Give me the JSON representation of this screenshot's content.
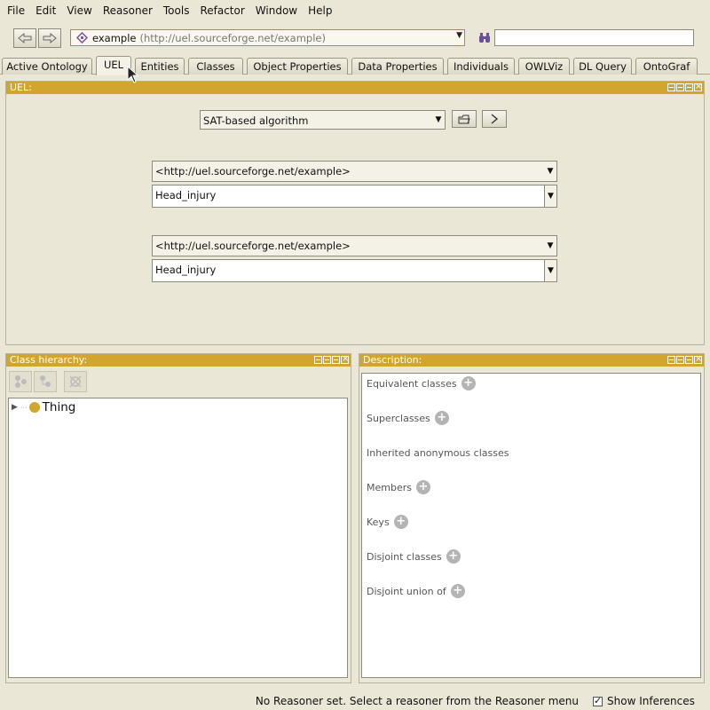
{
  "menu": [
    "File",
    "Edit",
    "View",
    "Reasoner",
    "Tools",
    "Refactor",
    "Window",
    "Help"
  ],
  "toolbar": {
    "back_icon": "back-arrow-icon",
    "forward_icon": "forward-arrow-icon",
    "ontology_name": "example",
    "ontology_iri": "(http://uel.sourceforge.net/example)",
    "search_value": ""
  },
  "tabs": [
    {
      "label": "Active Ontology",
      "active": false
    },
    {
      "label": "UEL",
      "active": true
    },
    {
      "label": "Entities",
      "active": false
    },
    {
      "label": "Classes",
      "active": false
    },
    {
      "label": "Object Properties",
      "active": false
    },
    {
      "label": "Data Properties",
      "active": false
    },
    {
      "label": "Individuals",
      "active": false
    },
    {
      "label": "OWLViz",
      "active": false
    },
    {
      "label": "DL Query",
      "active": false
    },
    {
      "label": "OntoGraf",
      "active": false
    }
  ],
  "uel": {
    "header": "UEL:",
    "algorithm": "SAT-based algorithm",
    "ontology1": "<http://uel.sourceforge.net/example>",
    "class1": "Head_injury",
    "ontology2": "<http://uel.sourceforge.net/example>",
    "class2": "Head_injury"
  },
  "hierarchy": {
    "header": "Class hierarchy:",
    "root": "Thing"
  },
  "description": {
    "header": "Description:",
    "rows": [
      {
        "label": "Equivalent classes",
        "addable": true
      },
      {
        "label": "Superclasses",
        "addable": true
      },
      {
        "label": "Inherited anonymous classes",
        "addable": false
      },
      {
        "label": "Members",
        "addable": true
      },
      {
        "label": "Keys",
        "addable": true
      },
      {
        "label": "Disjoint classes",
        "addable": true
      },
      {
        "label": "Disjoint union of",
        "addable": true
      }
    ]
  },
  "status": {
    "message": "No Reasoner set. Select a reasoner from the Reasoner menu",
    "show_inferences": "Show Inferences",
    "show_inferences_checked": true
  },
  "colors": {
    "header_gold": "#d2a52c",
    "background": "#ebe7d7"
  }
}
